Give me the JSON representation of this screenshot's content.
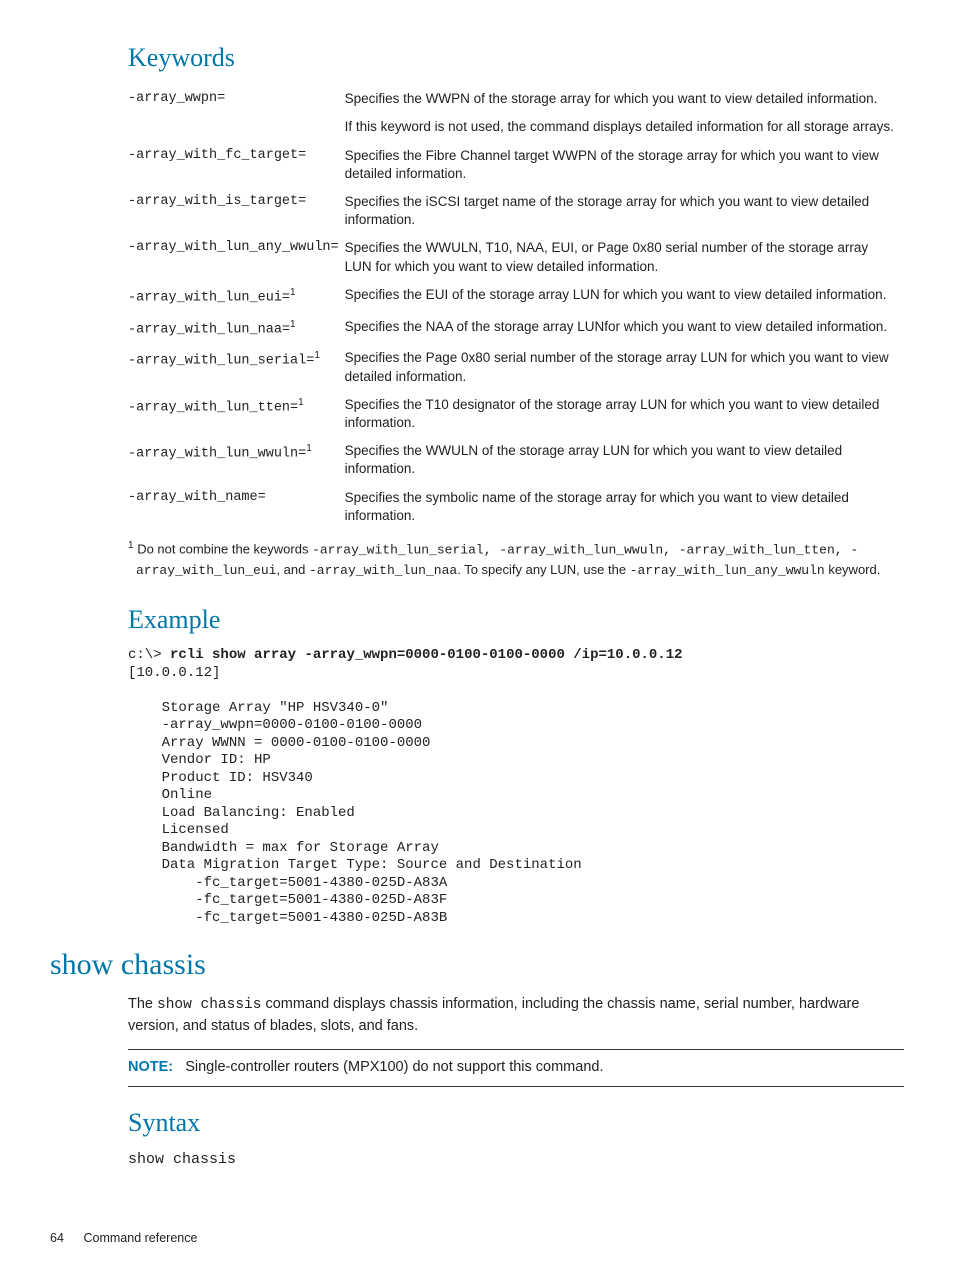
{
  "headings": {
    "keywords": "Keywords",
    "example": "Example",
    "show_chassis": "show chassis",
    "syntax": "Syntax"
  },
  "keywords_table": [
    {
      "kw": "-array_wwpn=",
      "sup": "",
      "desc": "Specifies the WWPN of the storage array for which you want to view detailed information."
    },
    {
      "kw": "",
      "sup": "",
      "desc": "If this keyword is not used, the command displays detailed information for all storage arrays."
    },
    {
      "kw": "-array_with_fc_target=",
      "sup": "",
      "desc": "Specifies the Fibre Channel target WWPN of the storage array for which you want to view detailed information."
    },
    {
      "kw": "-array_with_is_target=",
      "sup": "",
      "desc": "Specifies the iSCSI target name of the storage array for which you want to view detailed information."
    },
    {
      "kw": "-array_with_lun_any_wwuln=",
      "sup": "",
      "desc": "Specifies the WWULN, T10, NAA, EUI, or Page 0x80 serial number of the storage array LUN for which you want to view detailed information."
    },
    {
      "kw": "-array_with_lun_eui=",
      "sup": "1",
      "desc": "Specifies the EUI of the storage array LUN for which you want to view detailed information."
    },
    {
      "kw": "-array_with_lun_naa=",
      "sup": "1",
      "desc": "Specifies the NAA of the storage array LUNfor which you want to view detailed information."
    },
    {
      "kw": "-array_with_lun_serial=",
      "sup": "1",
      "desc": "Specifies the Page 0x80 serial number of the storage array LUN for which you want to view detailed information."
    },
    {
      "kw": "-array_with_lun_tten=",
      "sup": "1",
      "desc": "Specifies the T10 designator of the storage array LUN for which you want to view detailed information."
    },
    {
      "kw": "-array_with_lun_wwuln=",
      "sup": "1",
      "desc": "Specifies the WWULN of the storage array LUN for which you want to view detailed information."
    },
    {
      "kw": "-array_with_name=",
      "sup": "",
      "desc": "Specifies the symbolic name of the storage array for which you want to view detailed information."
    }
  ],
  "footnote": {
    "num": "1",
    "pre": "Do not combine the keywords ",
    "kws": "-array_with_lun_serial, -array_with_lun_wwuln, -array_with_lun_tten, -array_with_lun_eui",
    "mid1": ", and ",
    "kw2": "-array_with_lun_naa",
    "mid2": ". To specify any LUN, use the ",
    "kw3": "-array_with_lun_any_wwuln",
    "post": " keyword."
  },
  "example": {
    "prompt": "c:\\> ",
    "cmd": "rcli show array -array_wwpn=0000-0100-0100-0000 /ip=10.0.0.12",
    "output": "[10.0.0.12]\n\n    Storage Array \"HP HSV340-0\"\n    -array_wwpn=0000-0100-0100-0000\n    Array WWNN = 0000-0100-0100-0000\n    Vendor ID: HP\n    Product ID: HSV340\n    Online\n    Load Balancing: Enabled\n    Licensed\n    Bandwidth = max for Storage Array\n    Data Migration Target Type: Source and Destination\n        -fc_target=5001-4380-025D-A83A\n        -fc_target=5001-4380-025D-A83F\n        -fc_target=5001-4380-025D-A83B"
  },
  "show_chassis": {
    "intro_pre": "The ",
    "intro_cmd": "show chassis",
    "intro_post": " command displays chassis information, including the chassis name, serial number, hardware version, and status of blades, slots, and fans.",
    "note_label": "NOTE:",
    "note_text": "Single-controller routers (MPX100) do not support this command.",
    "syntax": "show chassis"
  },
  "footer": {
    "page": "64",
    "title": "Command reference"
  }
}
